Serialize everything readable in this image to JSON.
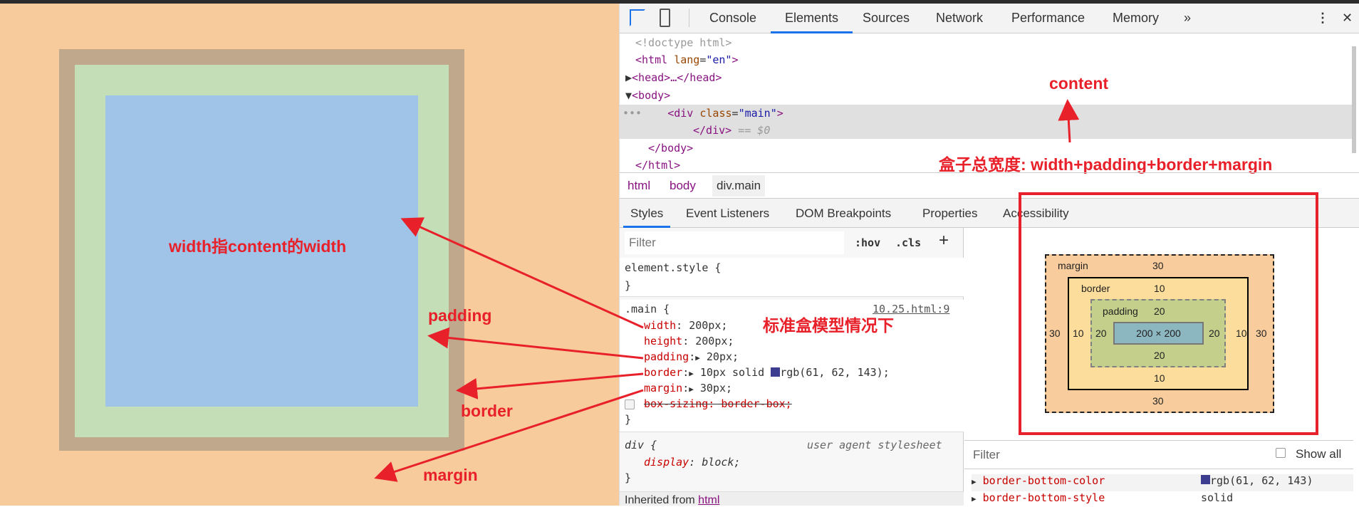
{
  "page": {
    "colors": {
      "margin": "#f8cb9c",
      "border": "#bfa88b",
      "padding": "#c4dfb8",
      "content": "#a0c4e8"
    }
  },
  "annotations": {
    "width_note": "width指content的width",
    "padding": "padding",
    "border": "border",
    "margin": "margin",
    "content": "content",
    "total_width": "盒子总宽度: width+padding+border+margin",
    "standard_model": "标准盒模型情况下",
    "color": "#e8202a"
  },
  "devtools": {
    "tabs": [
      "Console",
      "Elements",
      "Sources",
      "Network",
      "Performance",
      "Memory"
    ],
    "more": "»",
    "active_tab": "Elements",
    "dom": {
      "doctype": "<!doctype html>",
      "html_open": "<html",
      "lang_attr": "lang",
      "lang_val": "\"en\"",
      "head": "<head>…</head>",
      "body_open": "<body>",
      "div_open": "<div",
      "class_attr": "class",
      "class_val": "\"main\"",
      "div_close": "</div>",
      "dollar": " == $0",
      "body_close": "</body>",
      "html_close": "</html>",
      "ellipsis": "•••"
    },
    "breadcrumbs": [
      "html",
      "body",
      "div.main"
    ],
    "subtabs": [
      "Styles",
      "Event Listeners",
      "DOM Breakpoints",
      "Properties",
      "Accessibility"
    ],
    "filter_placeholder": "Filter",
    "hov": ":hov",
    "cls": ".cls",
    "plus": "+",
    "element_style": "element.style {",
    "close_brace": "}",
    "main_rule": {
      "selector": ".main {",
      "source": "10.25.html:9",
      "decls": [
        {
          "p": "width",
          "v": "200px;"
        },
        {
          "p": "height",
          "v": "200px;"
        },
        {
          "p": "padding",
          "v": "20px;"
        },
        {
          "p": "border",
          "v": "10px solid",
          "v2": "rgb(61, 62, 143);"
        },
        {
          "p": "margin",
          "v": "30px;"
        }
      ],
      "struck": "box-sizing: border-box;",
      "swatch": "#3d3e8f"
    },
    "div_rule": {
      "selector": "div {",
      "source": "user agent stylesheet",
      "decl_p": "display",
      "decl_v": "block;"
    },
    "inherited": "Inherited from",
    "inherited_tag": "html",
    "box_model": {
      "margin_label": "margin",
      "border_label": "border",
      "padding_label": "padding",
      "margin": "30",
      "border": "10",
      "padding": "20",
      "content": "200 × 200"
    },
    "computed": {
      "filter": "Filter",
      "show_all": "Show all",
      "rows": [
        {
          "p": "border-bottom-color",
          "v": "rgb(61, 62, 143)"
        },
        {
          "p": "border-bottom-style",
          "v": "solid"
        }
      ]
    }
  }
}
